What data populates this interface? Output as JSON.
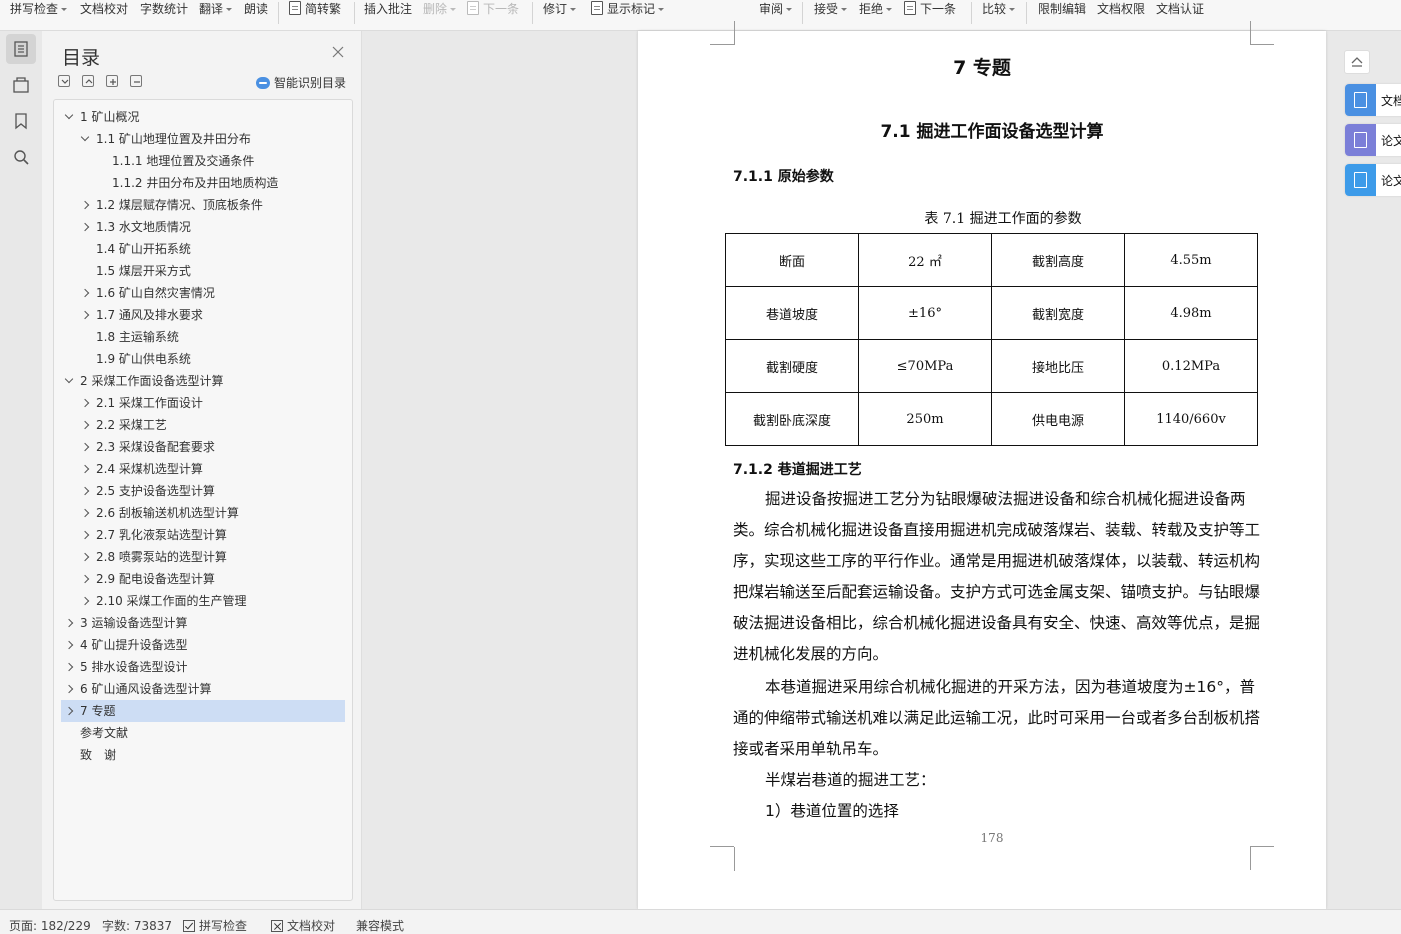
{
  "toolbar": {
    "items": [
      "拼写检查",
      "文档校对",
      "字数统计",
      "翻译",
      "朗读",
      "简转繁",
      "插入批注",
      "删除",
      "下一条",
      "修订",
      "显示标记",
      "审阅",
      "接受",
      "拒绝",
      "下一条",
      "比较",
      "限制编辑",
      "文档权限",
      "文档认证"
    ]
  },
  "toc": {
    "title": "目录",
    "smart_label": "智能识别目录",
    "items": [
      {
        "label": "1 矿山概况",
        "level": 1,
        "chevron": "open"
      },
      {
        "label": "1.1 矿山地理位置及井田分布",
        "level": 2,
        "chevron": "open"
      },
      {
        "label": "1.1.1 地理位置及交通条件",
        "level": 3,
        "chevron": "none"
      },
      {
        "label": "1.1.2 井田分布及井田地质构造",
        "level": 3,
        "chevron": "none"
      },
      {
        "label": "1.2 煤层赋存情况、顶底板条件",
        "level": 2,
        "chevron": "closed"
      },
      {
        "label": "1.3 水文地质情况",
        "level": 2,
        "chevron": "closed"
      },
      {
        "label": "1.4 矿山开拓系统",
        "level": 2,
        "chevron": "none"
      },
      {
        "label": "1.5 煤层开采方式",
        "level": 2,
        "chevron": "none"
      },
      {
        "label": "1.6 矿山自然灾害情况",
        "level": 2,
        "chevron": "closed"
      },
      {
        "label": "1.7 通风及排水要求",
        "level": 2,
        "chevron": "closed"
      },
      {
        "label": "1.8 主运输系统",
        "level": 2,
        "chevron": "none"
      },
      {
        "label": "1.9 矿山供电系统",
        "level": 2,
        "chevron": "none"
      },
      {
        "label": "2 采煤工作面设备选型计算",
        "level": 1,
        "chevron": "open"
      },
      {
        "label": "2.1 采煤工作面设计",
        "level": 2,
        "chevron": "closed"
      },
      {
        "label": "2.2  采煤工艺",
        "level": 2,
        "chevron": "closed"
      },
      {
        "label": "2.3 采煤设备配套要求",
        "level": 2,
        "chevron": "closed"
      },
      {
        "label": "2.4  采煤机选型计算",
        "level": 2,
        "chevron": "closed"
      },
      {
        "label": "2.5 支护设备选型计算",
        "level": 2,
        "chevron": "closed"
      },
      {
        "label": "2.6 刮板输送机机选型计算",
        "level": 2,
        "chevron": "closed"
      },
      {
        "label": "2.7  乳化液泵站选型计算",
        "level": 2,
        "chevron": "closed"
      },
      {
        "label": "2.8 喷雾泵站的选型计算",
        "level": 2,
        "chevron": "closed"
      },
      {
        "label": "2.9  配电设备选型计算",
        "level": 2,
        "chevron": "closed"
      },
      {
        "label": "2.10 采煤工作面的生产管理",
        "level": 2,
        "chevron": "closed"
      },
      {
        "label": "3 运输设备选型计算",
        "level": 1,
        "chevron": "closed"
      },
      {
        "label": "4 矿山提升设备选型",
        "level": 1,
        "chevron": "closed"
      },
      {
        "label": "5 排水设备选型设计",
        "level": 1,
        "chevron": "closed"
      },
      {
        "label": "6 矿山通风设备选型计算",
        "level": 1,
        "chevron": "closed"
      },
      {
        "label": "7 专题",
        "level": 1,
        "chevron": "closed",
        "selected": true
      },
      {
        "label": "参考文献",
        "level": 1,
        "chevron": "none"
      },
      {
        "label": "致　谢",
        "level": 1,
        "chevron": "none"
      }
    ]
  },
  "document": {
    "chapter_title": "7 专题",
    "section_title": "7.1 掘进工作面设备选型计算",
    "subsection_1": "7.1.1 原始参数",
    "table_caption": "表 7.1 掘进工作面的参数",
    "table_rows": [
      [
        "断面",
        "22 ㎡",
        "截割高度",
        "4.55m"
      ],
      [
        "巷道坡度",
        "±16°",
        "截割宽度",
        "4.98m"
      ],
      [
        "截割硬度",
        "≤70MPa",
        "接地比压",
        "0.12MPa"
      ],
      [
        "截割卧底深度",
        "250m",
        "供电电源",
        "1140/660v"
      ]
    ],
    "subsection_2": "7.1.2 巷道掘进工艺",
    "para_1": "掘进设备按掘进工艺分为钻眼爆破法掘进设备和综合机械化掘进设备两类。综合机械化掘进设备直接用掘进机完成破落煤岩、装载、转载及支护等工序，实现这些工序的平行作业。通常是用掘进机破落煤体，以装载、转运机构把煤岩输送至后配套运输设备。支护方式可选金属支架、锚喷支护。与钻眼爆破法掘进设备相比，综合机械化掘进设备具有安全、快速、高效等优点，是掘进机械化发展的方向。",
    "para_2": "本巷道掘进采用综合机械化掘进的开采方法，因为巷道坡度为±16°，普通的伸缩带式输送机难以满足此运输工况，此时可采用一台或者多台刮板机搭接或者采用单轨吊车。",
    "para_3": "半煤岩巷道的掘进工艺：",
    "para_4": "1）巷道位置的选择",
    "page_number": "178"
  },
  "side_tabs": [
    "文档",
    "论文",
    "论文"
  ],
  "status": {
    "page": "页面: 182/229",
    "words": "字数: 73837",
    "spell": "拼写检查",
    "proof": "文档校对",
    "compat": "兼容模式"
  },
  "colors": {
    "toc_selected": "#cdddf4",
    "side_tab_1": "#4a90e2",
    "side_tab_2": "#7b7fd8",
    "side_tab_3": "#3d9be9"
  }
}
